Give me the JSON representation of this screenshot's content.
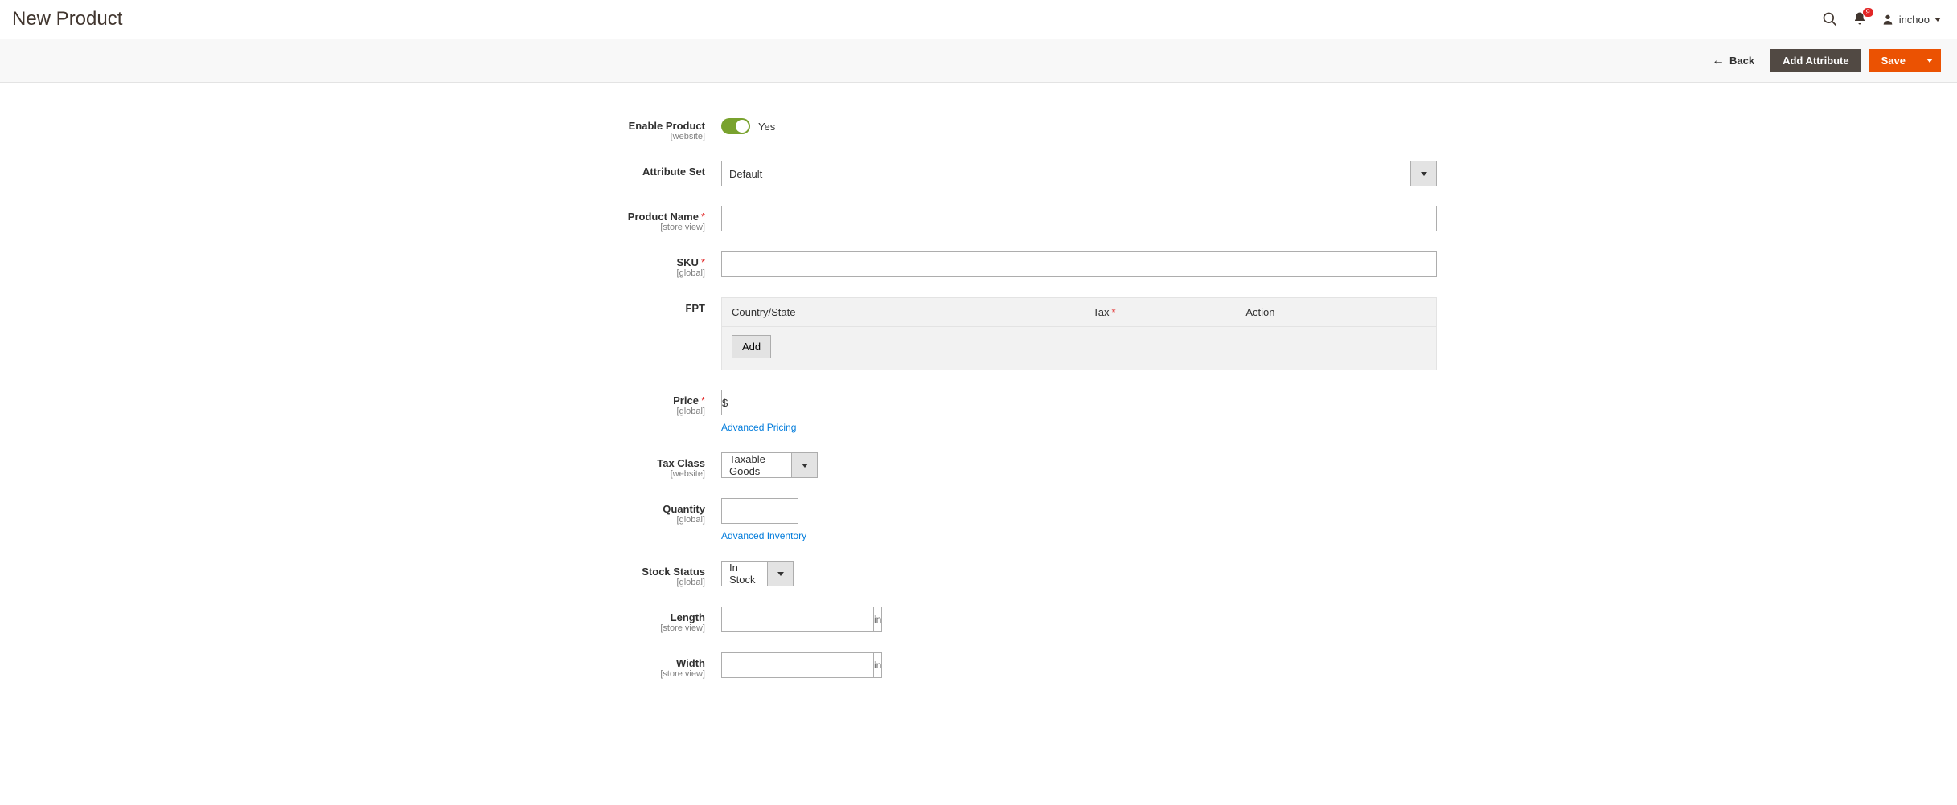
{
  "header": {
    "page_title": "New Product",
    "notifications_count": "9",
    "username": "inchoo"
  },
  "toolbar": {
    "back_label": "Back",
    "add_attribute_label": "Add Attribute",
    "save_label": "Save"
  },
  "form": {
    "enable_product": {
      "label": "Enable Product",
      "scope": "[website]",
      "value_text": "Yes"
    },
    "attribute_set": {
      "label": "Attribute Set",
      "value": "Default"
    },
    "product_name": {
      "label": "Product Name",
      "scope": "[store view]",
      "value": ""
    },
    "sku": {
      "label": "SKU",
      "scope": "[global]",
      "value": ""
    },
    "fpt": {
      "label": "FPT",
      "col_country": "Country/State",
      "col_tax": "Tax",
      "col_action": "Action",
      "add_label": "Add"
    },
    "price": {
      "label": "Price",
      "scope": "[global]",
      "currency": "$",
      "value": "",
      "advanced_link": "Advanced Pricing"
    },
    "tax_class": {
      "label": "Tax Class",
      "scope": "[website]",
      "value": "Taxable Goods"
    },
    "quantity": {
      "label": "Quantity",
      "scope": "[global]",
      "value": "",
      "advanced_link": "Advanced Inventory"
    },
    "stock_status": {
      "label": "Stock Status",
      "scope": "[global]",
      "value": "In Stock"
    },
    "length": {
      "label": "Length",
      "scope": "[store view]",
      "value": "",
      "unit": "in"
    },
    "width": {
      "label": "Width",
      "scope": "[store view]",
      "value": "",
      "unit": "in"
    }
  }
}
